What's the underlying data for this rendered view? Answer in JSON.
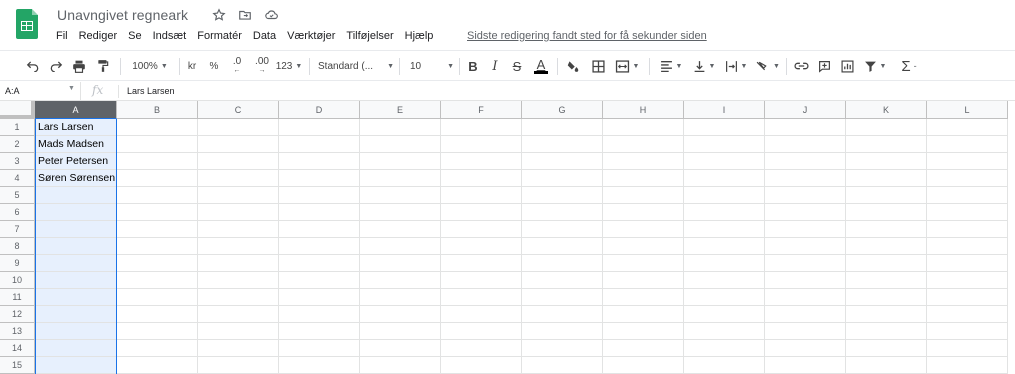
{
  "app": {
    "doc_title": "Unavngivet regneark",
    "last_edit": "Sidste redigering fandt sted for få sekunder siden",
    "brand_color": "#23a566"
  },
  "title_icons": [
    "star-icon",
    "move-to-folder-icon",
    "cloud-status-icon"
  ],
  "menu": [
    "Fil",
    "Rediger",
    "Se",
    "Indsæt",
    "Formatér",
    "Data",
    "Værktøjer",
    "Tilføjelser",
    "Hjælp"
  ],
  "toolbar": {
    "zoom": "100%",
    "currency": "kr",
    "percent": "%",
    "decrease_decimal": ".0",
    "increase_decimal": ".00",
    "more_formats": "123",
    "font": "Standard (...",
    "font_size": "10",
    "bold": "B",
    "italic": "I",
    "strikethrough": "S",
    "text_color": "A",
    "functions": "Σ"
  },
  "formula_bar": {
    "name_box": "A:A",
    "fx": "fx",
    "content": "Lars Larsen"
  },
  "grid": {
    "columns": [
      "A",
      "B",
      "C",
      "D",
      "E",
      "F",
      "G",
      "H",
      "I",
      "J",
      "K",
      "L"
    ],
    "rows": [
      "1",
      "2",
      "3",
      "4",
      "5",
      "6",
      "7",
      "8",
      "9",
      "10",
      "11",
      "12",
      "13",
      "14",
      "15"
    ],
    "selected_column": "A",
    "cells": {
      "A1": "Lars Larsen",
      "A2": "Mads Madsen",
      "A3": "Peter Petersen",
      "A4": "Søren Sørensen"
    }
  }
}
